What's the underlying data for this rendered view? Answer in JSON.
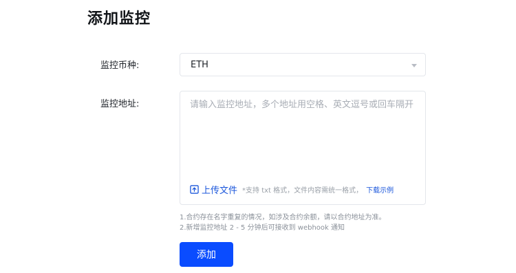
{
  "page": {
    "title": "添加监控"
  },
  "form": {
    "currency": {
      "label": "监控币种:",
      "value": "ETH"
    },
    "address": {
      "label": "监控地址:",
      "placeholder": "请输入监控地址，多个地址用空格、英文逗号或回车隔开",
      "value": ""
    },
    "upload": {
      "label": "上传文件",
      "hint": "*支持 txt 格式，文件内容需统一格式，",
      "download_label": "下载示例"
    },
    "notes": [
      "1.合约存在名字重复的情况，如涉及合约余额，请以合约地址为准。",
      "2.新增监控地址 2 - 5 分钟后可接收到 webhook 通知"
    ],
    "submit_label": "添加"
  },
  "icons": {
    "upload": "upload-file-icon",
    "select_caret": "caret-down-icon"
  },
  "colors": {
    "primary": "#0a4cff",
    "link": "#1a56db",
    "muted": "#8a9099",
    "border": "#e3e6eb"
  }
}
